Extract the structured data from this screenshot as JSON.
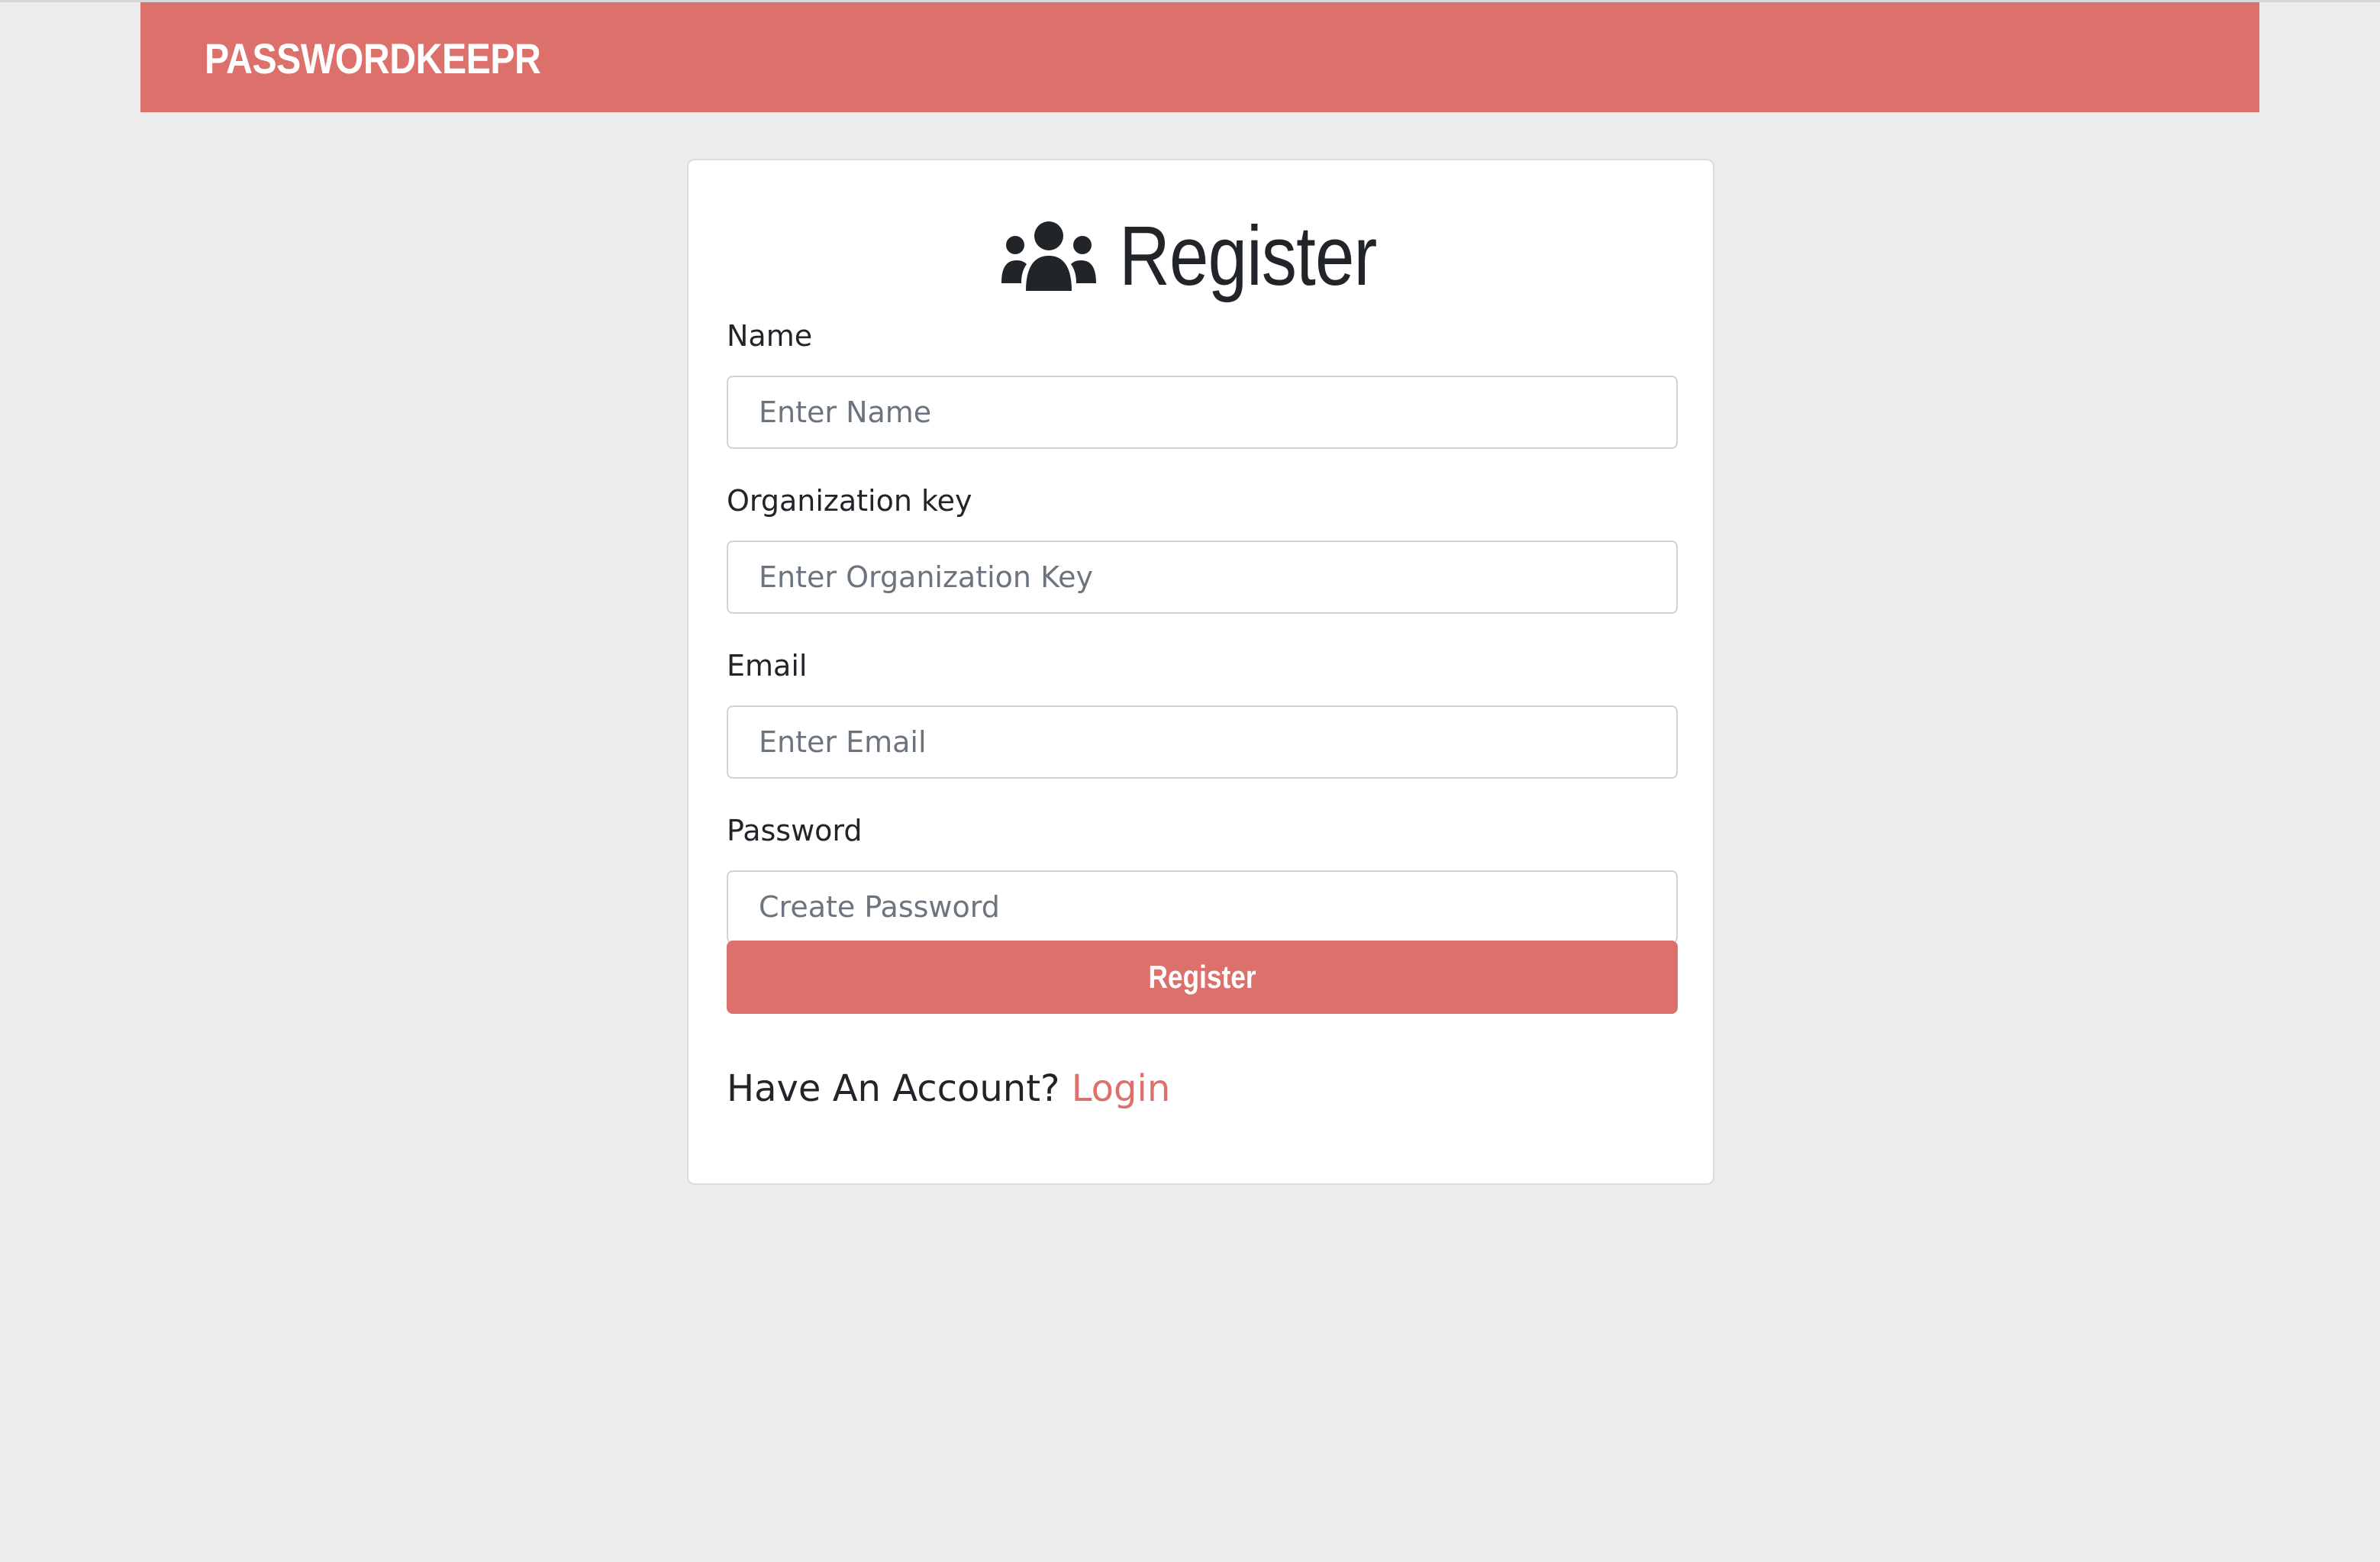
{
  "app": {
    "brand": "PASSWORDKEEPR"
  },
  "form": {
    "title": "Register",
    "title_icon": "users-icon",
    "fields": [
      {
        "label": "Name",
        "placeholder": "Enter Name",
        "value": ""
      },
      {
        "label": "Organization key",
        "placeholder": "Enter Organization Key",
        "value": ""
      },
      {
        "label": "Email",
        "placeholder": "Enter Email",
        "value": ""
      },
      {
        "label": "Password",
        "placeholder": "Create Password",
        "value": ""
      }
    ],
    "submit_label": "Register"
  },
  "footer": {
    "prompt": "Have An Account?",
    "link_label": "Login"
  },
  "colors": {
    "accent": "#dc706a",
    "background": "#ececec",
    "card": "#ffffff",
    "text": "#212529"
  }
}
